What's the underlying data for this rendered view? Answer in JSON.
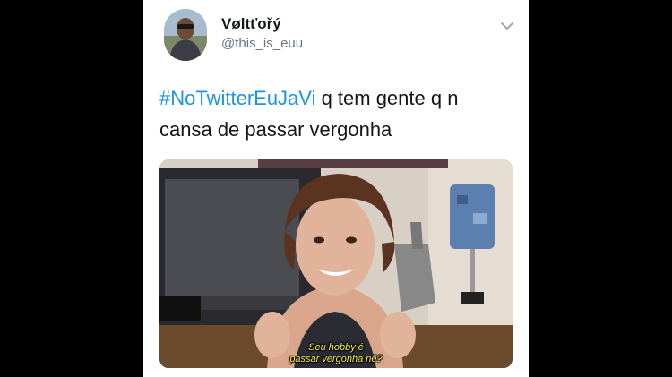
{
  "tweet": {
    "display_name": "Vøltťořý",
    "handle": "@this_is_euu",
    "menu_icon": "chevron-down-icon",
    "hashtag": "#NoTwitterEuJaVi",
    "text_line1_rest": " q tem gente q n",
    "text_line2": "cansa de passar vergonha"
  },
  "media": {
    "subtitle_line1": "Seu hobby é",
    "subtitle_line2": "passar vergonha né?",
    "subtitle_color": "#fff34a"
  },
  "colors": {
    "hashtag": "#1b95e0",
    "name": "#14171a",
    "handle": "#657786",
    "background": "#000000"
  }
}
